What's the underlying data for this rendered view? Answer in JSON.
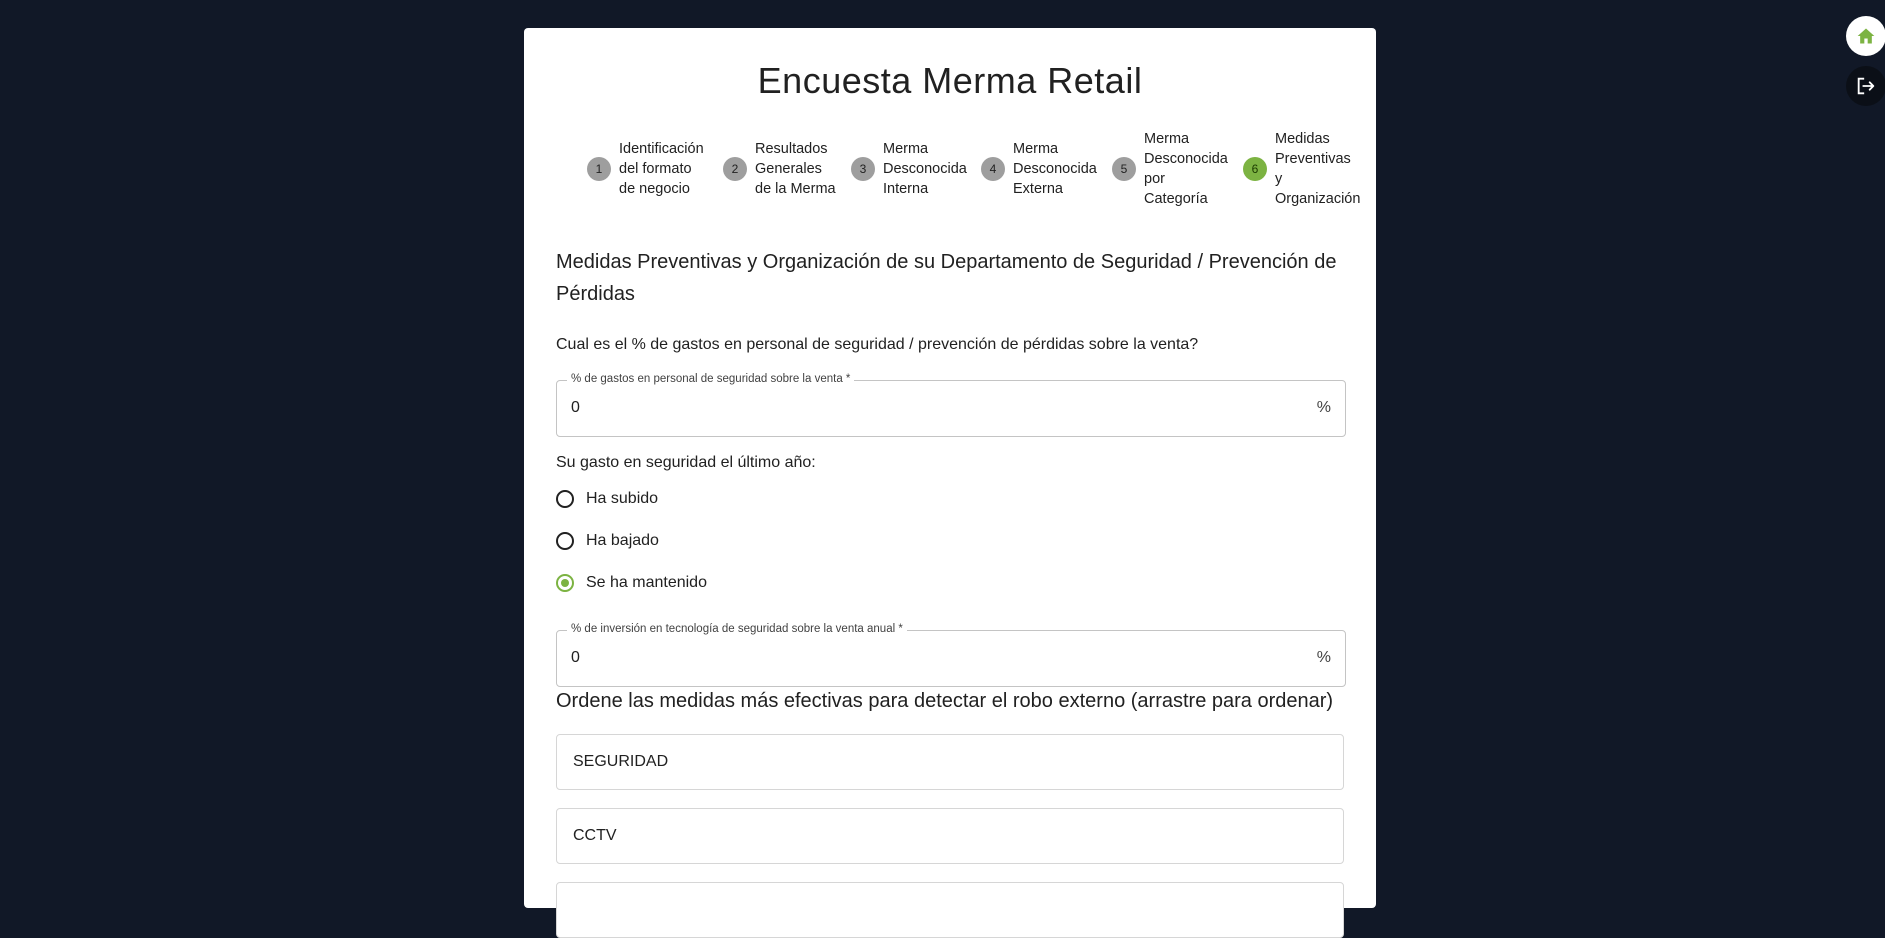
{
  "title": "Encuesta Merma Retail",
  "steps": [
    {
      "number": "1",
      "label": "Identificación\ndel formato\nde negocio"
    },
    {
      "number": "2",
      "label": "Resultados\nGenerales\nde la Merma"
    },
    {
      "number": "3",
      "label": "Merma\nDesconocida\nInterna"
    },
    {
      "number": "4",
      "label": "Merma\nDesconocida\nExterna"
    },
    {
      "number": "5",
      "label": "Merma\nDesconocida\npor\nCategoría"
    },
    {
      "number": "6",
      "label": "Medidas\nPreventivas\ny\nOrganización"
    }
  ],
  "active_step": 6,
  "section_title": "Medidas Preventivas y Organización de su Departamento de Seguridad / Prevención de Pérdidas",
  "question1": "Cual es el % de gastos en personal de seguridad / prevención de pérdidas sobre la venta?",
  "field1": {
    "label": "% de gastos en personal de seguridad sobre la venta *",
    "value": "0",
    "suffix": "%"
  },
  "question2": "Su gasto en seguridad el último año:",
  "radio_options": [
    {
      "label": "Ha subido",
      "checked": false
    },
    {
      "label": "Ha bajado",
      "checked": false
    },
    {
      "label": "Se ha mantenido",
      "checked": true
    }
  ],
  "field2": {
    "label": "% de inversión en tecnología de seguridad sobre la venta anual *",
    "value": "0",
    "suffix": "%"
  },
  "sort_title": "Ordene las medidas más efectivas para detectar el robo externo (arrastre para ordenar)",
  "sort_items": [
    "SEGURIDAD",
    "CCTV",
    ""
  ],
  "colors": {
    "background": "#111827",
    "accent": "#7cb342",
    "step_inactive": "#9e9e9e"
  },
  "icons": {
    "home": "home-icon",
    "logout": "logout-icon"
  }
}
